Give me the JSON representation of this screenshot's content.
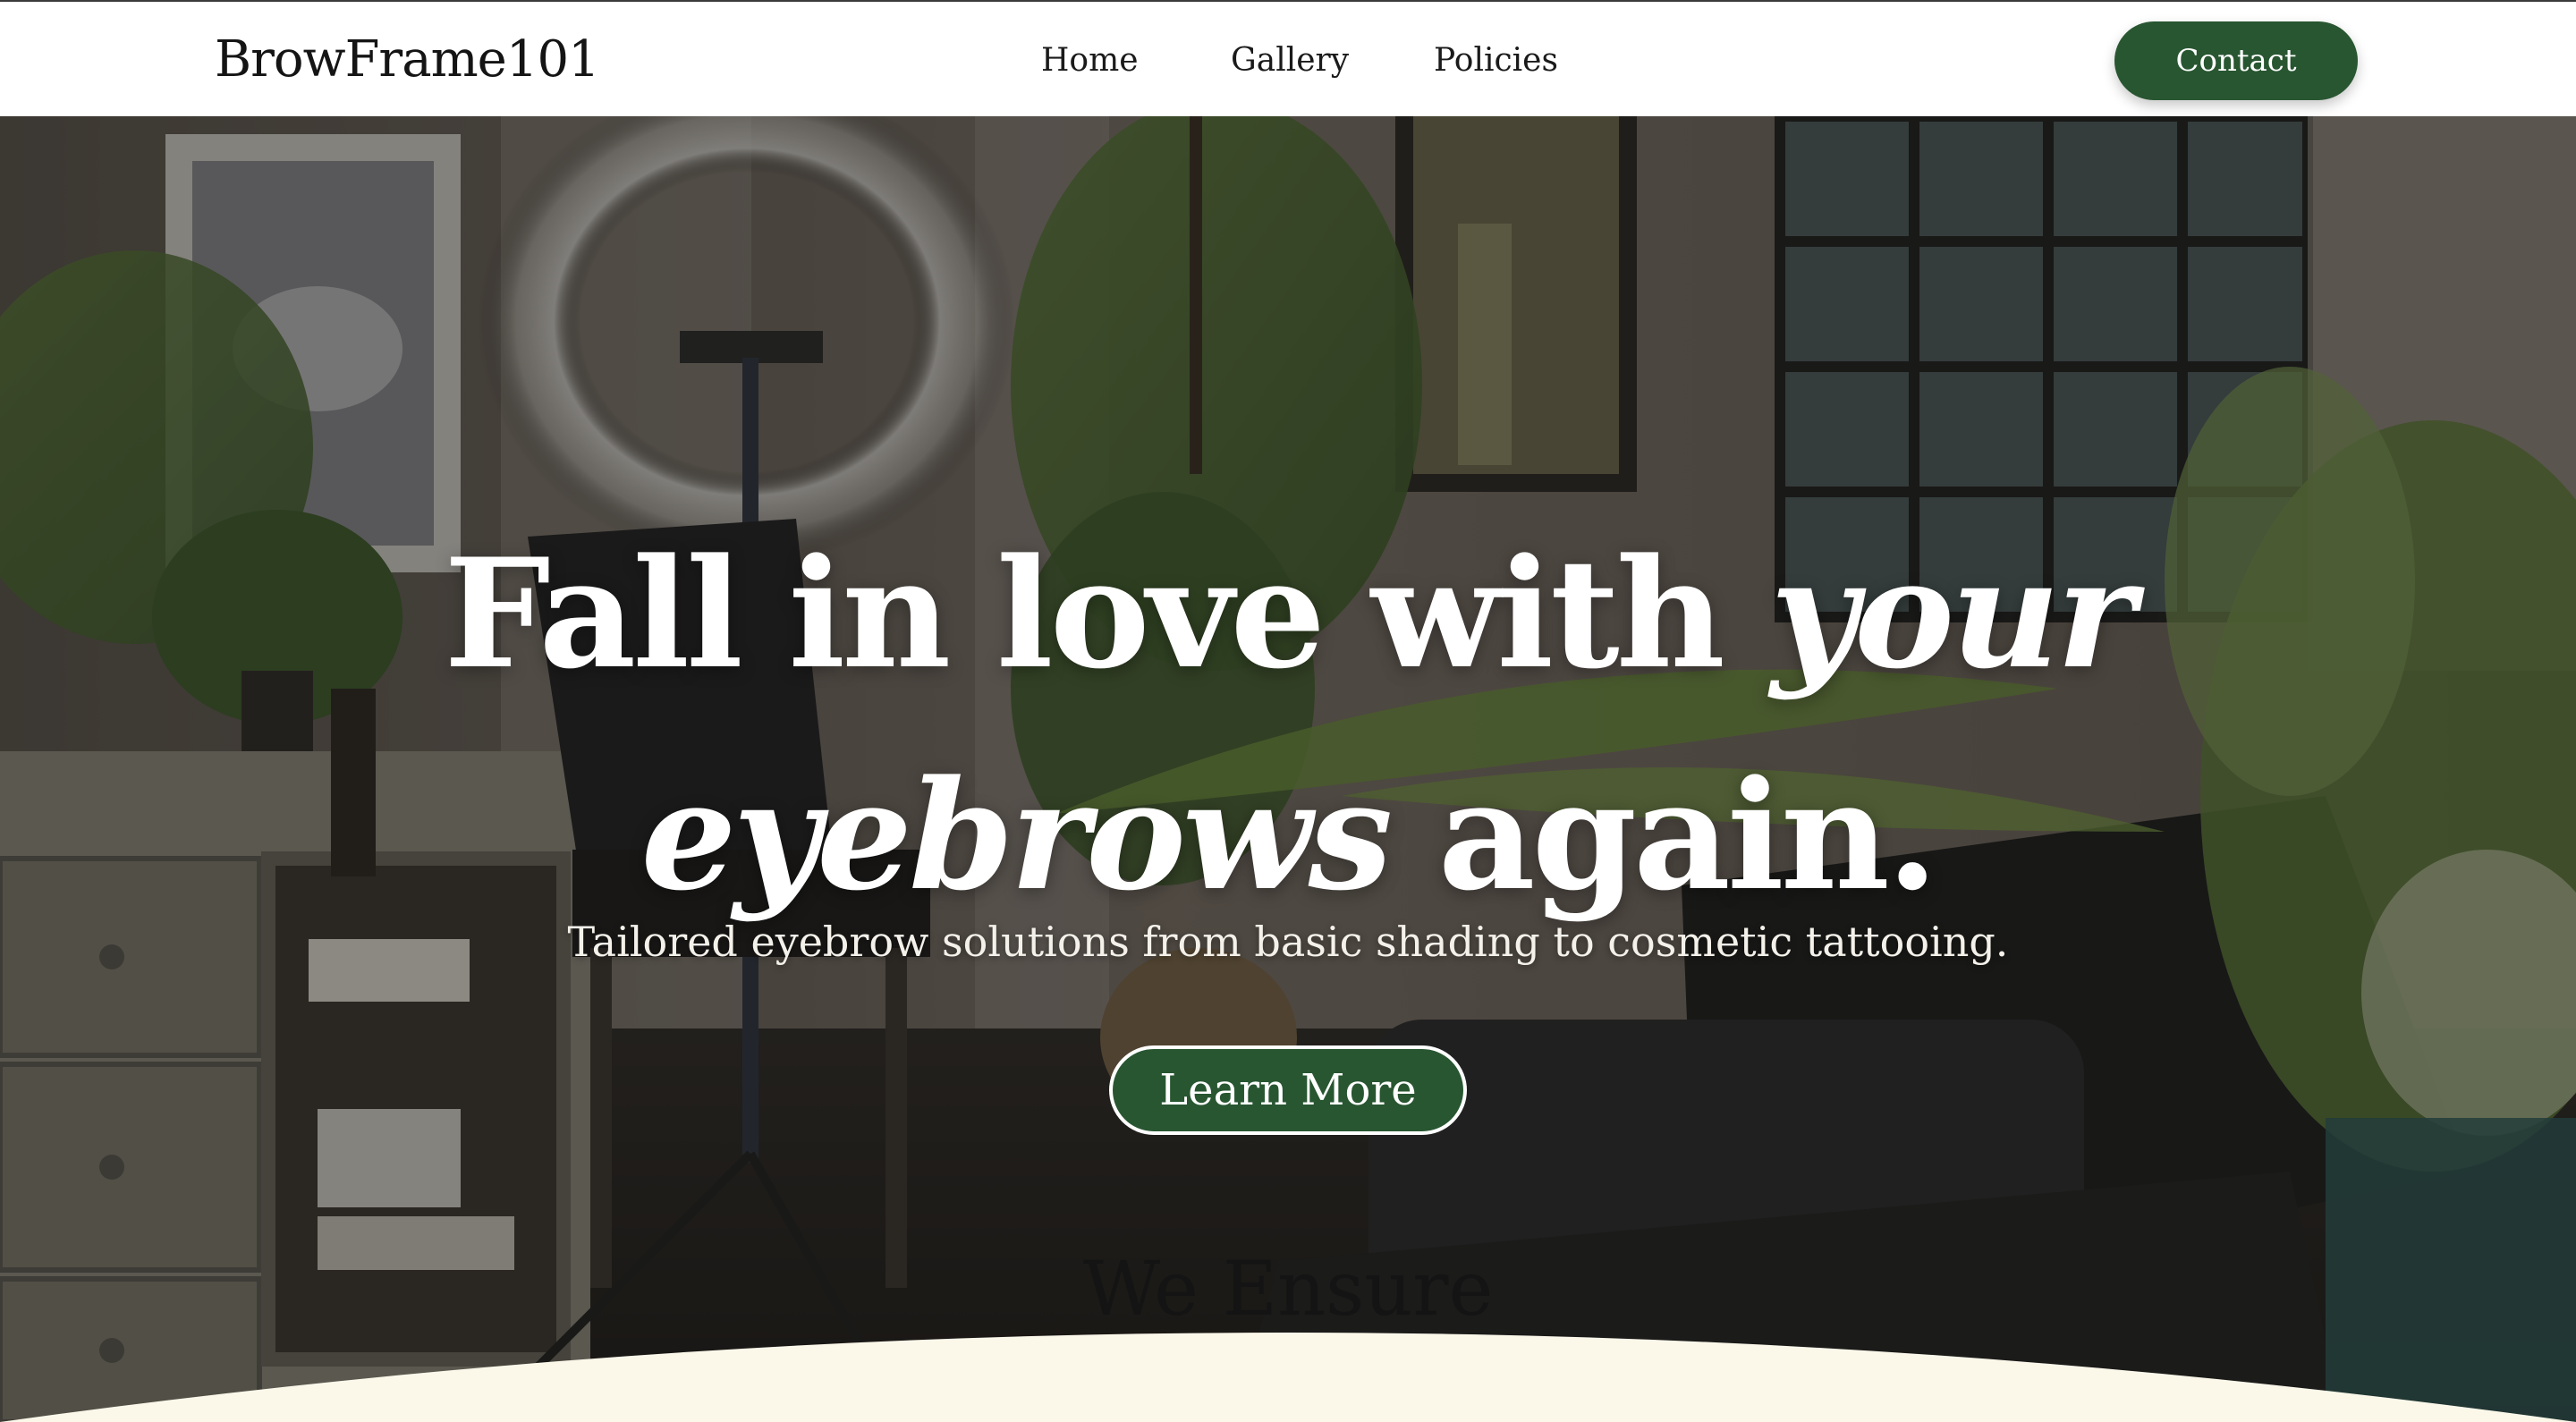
{
  "header": {
    "brand": "BrowFrame101",
    "nav": {
      "home": "Home",
      "gallery": "Gallery",
      "policies": "Policies"
    },
    "contact_label": "Contact"
  },
  "hero": {
    "headline_part1": "Fall in love with ",
    "headline_part2": "your",
    "headline_part3": "eyebrows",
    "headline_part4": " again.",
    "subheadline": "Tailored eyebrow solutions from basic shading to cosmetic tattooing.",
    "cta_label": "Learn More"
  },
  "next_section": {
    "title": "We Ensure"
  },
  "colors": {
    "accent": "#285631",
    "header_bg": "#ffffff",
    "section_bg": "#fbf8ea",
    "hero_text": "#ffffff"
  }
}
